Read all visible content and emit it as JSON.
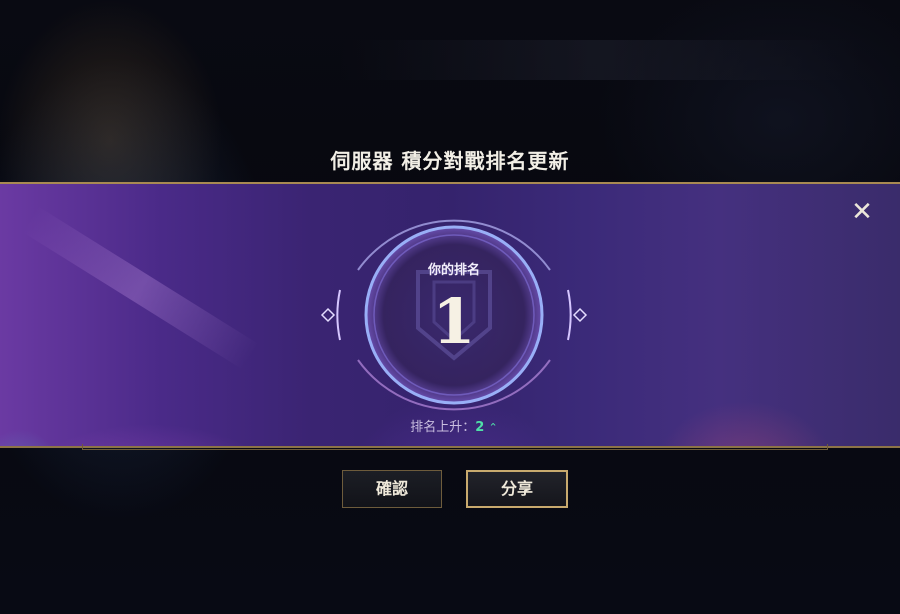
{
  "dialog": {
    "title": "伺服器 積分對戰排名更新",
    "close_label": "✕"
  },
  "rank": {
    "label": "你的排名",
    "value": "1",
    "change_label": "排名上升：",
    "change_value": "2",
    "change_arrow": "⌃"
  },
  "buttons": {
    "confirm": "確認",
    "share": "分享"
  },
  "colors": {
    "accent_gold": "#c8aa6e",
    "banner_purple": "#3a2472",
    "rank_up_green": "#4fe0a8"
  }
}
